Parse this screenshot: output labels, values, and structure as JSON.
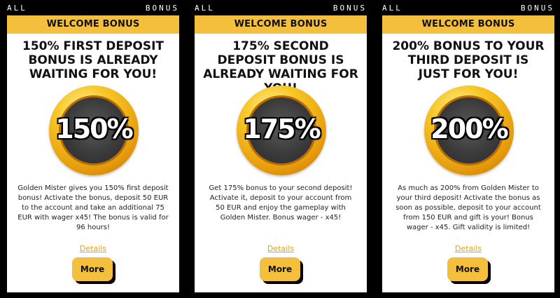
{
  "columns": [
    {
      "header_left": "ALL",
      "header_right": "BONUS",
      "banner": "WELCOME BONUS",
      "title": "150% FIRST DEPOSIT BONUS IS ALREADY WAITING FOR YOU!",
      "coin": "150%",
      "description": "Golden Mister gives you 150% first deposit bonus! Activate the bonus, deposit 50 EUR to the account and take an additional 75 EUR with wager x45! The bonus is valid for 96 hours!",
      "details": "Details",
      "more": "More"
    },
    {
      "header_left": "ALL",
      "header_right": "BONUS",
      "banner": "WELCOME BONUS",
      "title": "175% SECOND DEPOSIT BONUS IS ALREADY WAITING FOR YOU!",
      "coin": "175%",
      "description": "Get 175% bonus to your second deposit! Activate it, deposit to your account from 50 EUR and enjoy the gameplay with Golden Mister. Bonus wager - x45!",
      "details": "Details",
      "more": "More"
    },
    {
      "header_left": "ALL",
      "header_right": "BONUS",
      "banner": "WELCOME BONUS",
      "title": "200% BONUS TO YOUR THIRD DEPOSIT IS JUST FOR YOU!",
      "coin": "200%",
      "description": "As much as 200% from Golden Mister to your third deposit! Activate the bonus as soon as possible, deposit to your account from 150 EUR and gift is your! Bonus wager - x45. Gift validity is limited!",
      "details": "Details",
      "more": "More"
    }
  ],
  "colors": {
    "accent": "#f4bf3c",
    "link": "#e3a21d",
    "background": "#000000",
    "card": "#ffffff"
  }
}
